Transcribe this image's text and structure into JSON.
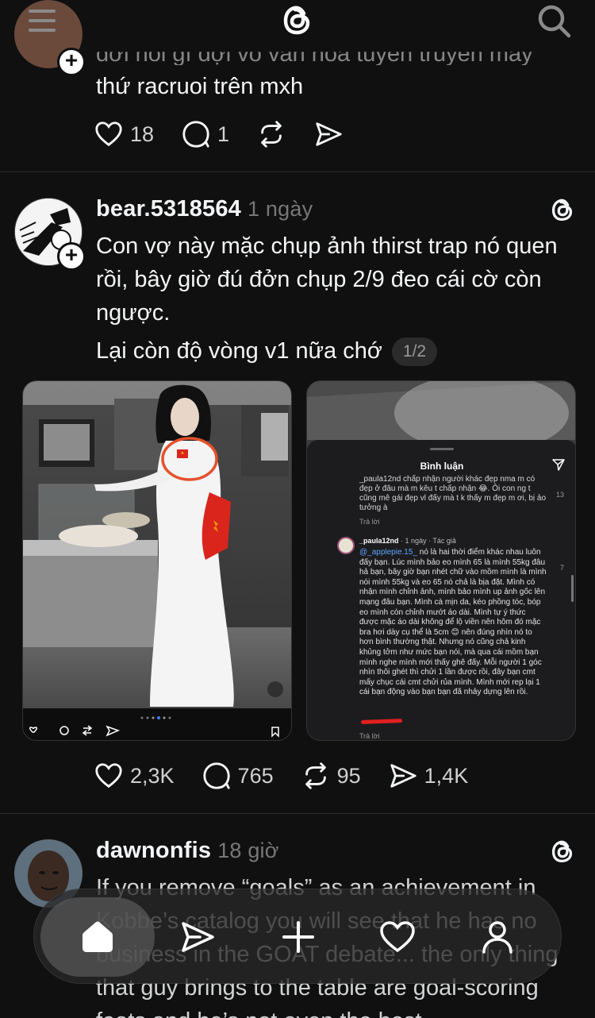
{
  "header": {
    "menu_icon": "hamburger-menu-icon",
    "logo_icon": "threads-logo-icon",
    "search_icon": "search-icon"
  },
  "previous_post": {
    "text_line_partial": "đời nói gì đợi vô văn hóa tuyên truyền mấy",
    "text_line": "thứ racruoi trên mxh",
    "likes": "18",
    "replies": "1"
  },
  "post": {
    "username": "bear.5318564",
    "time": "1 ngày",
    "text": "Con vợ này mặc chụp ảnh thirst trap nó quen rồi, bây giờ đú đởn chụp 2/9 đeo cái cờ còn ngược.",
    "text2": "Lại còn độ vòng v1 nữa chớ",
    "page_indicator": "1/2",
    "likes": "2,3K",
    "replies": "765",
    "reposts": "95",
    "shares": "1,4K",
    "media2": {
      "sheet_title": "Bình luận",
      "snippet_top": "_paula12nd  chấp nhận người khác đẹp nma m có đẹp ở đâu mà m kêu t chấp nhận 😂. Ôi con ng t cũng mê gái đẹp vl đấy mà t k thấy m đẹp m ơi, bị ảo tưởng à",
      "reply_label_1": "Trả lời",
      "count_1": "13",
      "comment_user": "_paula12nd",
      "comment_meta": " · 1 ngày · Tác giả",
      "mention": "@_applepie.15_",
      "comment_body": " nó là hai thời điểm khác nhau luôn đấy bạn. Lúc mình bảo eo mình 65 là mình 55kg đâu hả bạn, bây giờ bạn nhét chữ vào mồm mình là mình nói mình 55kg và eo 65 nó chả là bịa đặt. Mình có nhận mình chỉnh ảnh, mình bảo mình up ảnh gốc lên mạng đâu bạn. Mình cà mịn da, kéo phồng tóc, bóp eo mình còn chỉnh mướt áo dài. Mình tự ý thức được mặc áo dài không để lộ viền nên hôm đó mặc bra hơi dày cụ thể là 5cm 😊 nên đúng nhìn nó to hơn bình thường thật. Nhưng nó cũng chả kinh khủng tởm như mức bạn nói, mà qua cái mồm bạn mình nghe mình mới thấy ghê đấy. Mỗi người 1 góc nhìn thôi ghét thì chửi 1 lần được rồi, đây bạn cmt mấy chục cái cmt chửi rủa mình. Mình mới rep lại 1 cái bạn động vào bạn bạn đã nhảy dựng lên rồi.",
      "count_2": "7",
      "reply_label_2": "Trả lời"
    }
  },
  "next_post": {
    "username": "dawnonfis",
    "time": "18 giờ",
    "text": "If you remove “goals” as an achievement in Kobbe’s catalog you will see that he has no business in the GOAT debate... the only thing that guy brings to the table are goal-scoring feats and he’s not even the best"
  },
  "bottom_nav": {
    "items": [
      "home-icon",
      "send-icon",
      "plus-icon",
      "heart-icon",
      "profile-icon"
    ]
  },
  "colors": {
    "background": "#101010",
    "text": "#f3f5f7",
    "muted": "#777777",
    "flag_red": "#da251d",
    "flag_yellow": "#ffcd00"
  }
}
